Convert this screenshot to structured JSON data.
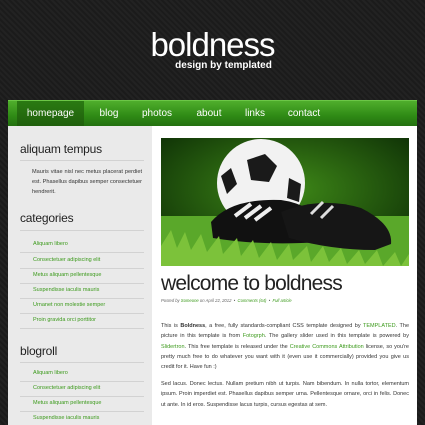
{
  "header": {
    "title": "boldness",
    "subtitle": "design by templated"
  },
  "nav": [
    "homepage",
    "blog",
    "photos",
    "about",
    "links",
    "contact"
  ],
  "sidebar": {
    "section1": {
      "title": "aliquam tempus",
      "text": "Mauris vitae nisl nec metus placerat perdiet est. Phasellus dapibus semper consectetuer hendrerit."
    },
    "categories": {
      "title": "categories",
      "items": [
        "Aliquam libero",
        "Consectetuer adipiscing elit",
        "Metus aliquam pellentesque",
        "Suspendisse iaculis mauris",
        "Urnanet non molestie semper",
        "Proin gravida orci porttitor"
      ]
    },
    "blogroll": {
      "title": "blogroll",
      "items": [
        "Aliquam libero",
        "Consectetuer adipiscing elit",
        "Metus aliquam pellentesque",
        "Suspendisse iaculis mauris"
      ]
    }
  },
  "post": {
    "title": "welcome to boldness",
    "meta": {
      "posted_by": "Posted by",
      "author": "Someone",
      "on": "on April 22, 2012",
      "comments": "Comments (64)",
      "full": "Full article"
    },
    "p1": {
      "t1": "This is ",
      "b1": "Boldness",
      "t2": ", a free, fully standards-compliant CSS template designed by ",
      "l1": "TEMPLATED",
      "t3": ". The picture in this template is from ",
      "l2": "Fotogrph",
      "t4": ". The gallery slider used in this template is powered by ",
      "l3": "Slidertron",
      "t5": ". This free template is released under the ",
      "l4": "Creative Commons Attribution",
      "t6": " license, so you're pretty much free to do whatever you want with it (even use it commercially) provided you give us credit for it. Have fun :)"
    },
    "p2": "Sed lacus. Donec lectus. Nullam pretium nibh ut turpis. Nam bibendum. In nulla tortor, elementum ipsum. Proin imperdiet est. Phasellus dapibus semper urna. Pellentesque ornare, orci in felis. Donec ut ante. In id eros. Suspendisse lacus turpis, cursus egestas at sem."
  },
  "colors": {
    "accent": "#3c9a1c",
    "nav_green": "#2f8a15"
  }
}
